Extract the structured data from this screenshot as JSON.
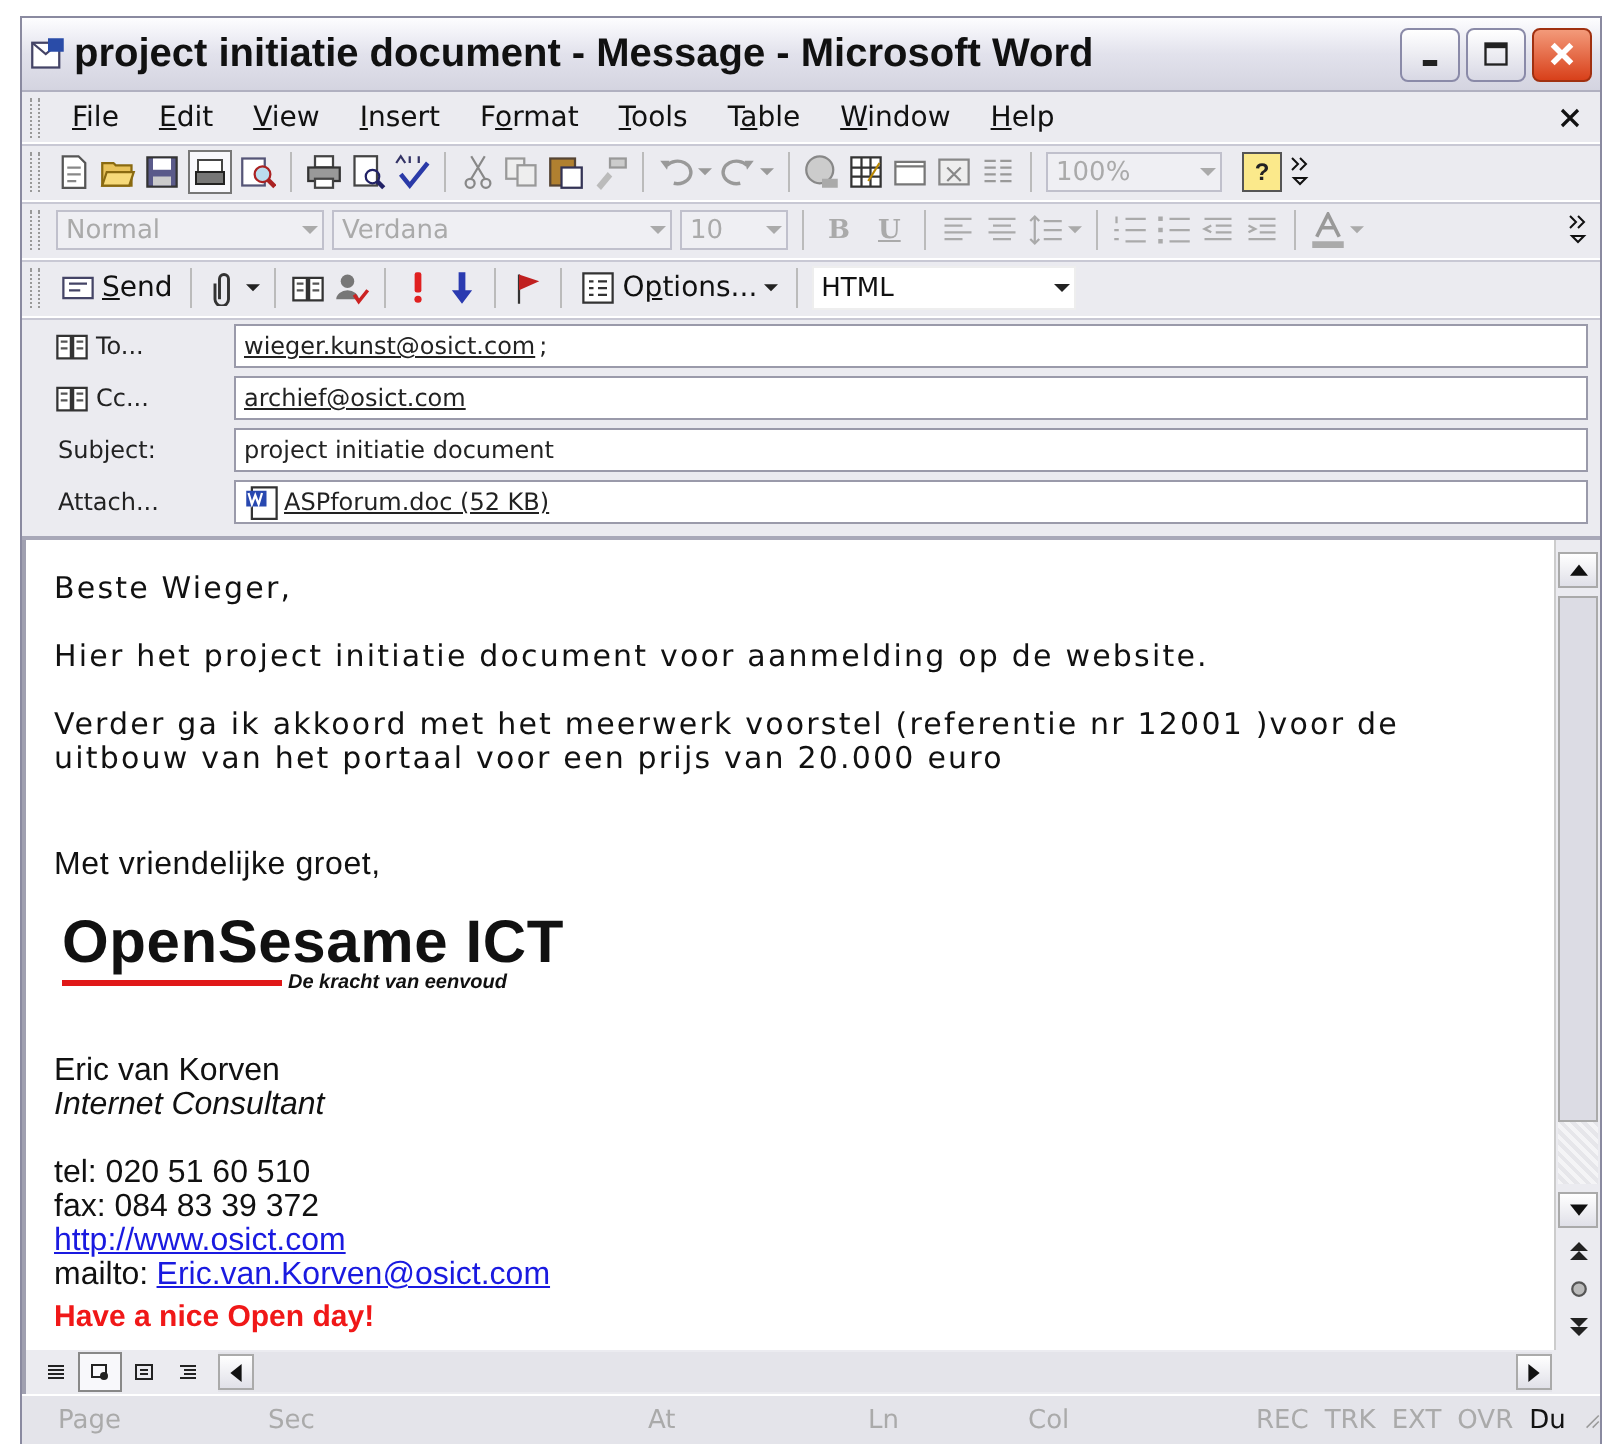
{
  "window": {
    "title": "project initiatie document - Message - Microsoft Word"
  },
  "menu": [
    {
      "key": "F",
      "after": "ile"
    },
    {
      "key": "E",
      "after": "dit"
    },
    {
      "key": "V",
      "after": "iew"
    },
    {
      "key": "I",
      "after": "nsert"
    },
    {
      "before": "F",
      "key": "o",
      "after": "rmat"
    },
    {
      "key": "T",
      "after": "ools"
    },
    {
      "before": "T",
      "key": "a",
      "after": "ble"
    },
    {
      "key": "W",
      "after": "indow"
    },
    {
      "key": "H",
      "after": "elp"
    }
  ],
  "standard_toolbar": {
    "zoom": {
      "value": "100%",
      "disabled": true
    },
    "help": "?"
  },
  "formatting_toolbar": {
    "style": {
      "value": "Normal",
      "disabled": true
    },
    "font": {
      "value": "Verdana",
      "disabled": true
    },
    "size": {
      "value": "10",
      "disabled": true
    },
    "bold": {
      "label": "B",
      "disabled": true
    },
    "underline": {
      "label": "U",
      "disabled": true
    }
  },
  "mail_toolbar": {
    "send": {
      "key": "S",
      "after": "end"
    },
    "options": {
      "before": "O",
      "key": "p",
      "after": "tions..."
    },
    "format": "HTML"
  },
  "fields": [
    {
      "kind": "address",
      "label": "To...",
      "value": "wieger.kunst@osict.com",
      "suffix": ";"
    },
    {
      "kind": "address",
      "label": "Cc...",
      "value": "archief@osict.com"
    },
    {
      "kind": "text",
      "label": "Subject:",
      "value": "project initiatie document"
    },
    {
      "kind": "attachment",
      "label": "Attach...",
      "value": "ASPforum.doc (52 KB)"
    }
  ],
  "body": {
    "greeting": "Beste Wieger,",
    "paragraphs": [
      "Hier het project initiatie document voor aanmelding op de website.",
      "Verder ga ik akkoord met het meerwerk voorstel (referentie nr 12001 )voor de uitbouw van het portaal voor een prijs van 20.000 euro"
    ],
    "closing": "Met vriendelijke groet,",
    "logo": {
      "name": "OpenSesame ICT",
      "tagline": "De kracht van eenvoud"
    },
    "signature": [
      {
        "kind": "plain",
        "text": "Eric van Korven"
      },
      {
        "kind": "italic",
        "text": "Internet Consultant"
      }
    ],
    "contact": [
      {
        "kind": "plain",
        "text": "tel: 020 51 60 510"
      },
      {
        "kind": "plain",
        "text": "fax: 084 83 39 372"
      },
      {
        "kind": "link",
        "text": "http://www.osict.com"
      },
      {
        "kind": "link",
        "prefix": "mailto:",
        "text": "Eric.van.Korven@osict.com"
      }
    ],
    "motto": "Have a nice Open day!"
  },
  "view_buttons": [
    {
      "selected": false
    },
    {
      "selected": true
    },
    {
      "selected": false
    },
    {
      "selected": false
    }
  ],
  "status_bar": {
    "fields": [
      "Page",
      "Sec",
      "At",
      "Ln",
      "Col"
    ],
    "indicators": [
      {
        "label": "REC",
        "disabled": true
      },
      {
        "label": "TRK",
        "disabled": true
      },
      {
        "label": "EXT",
        "disabled": true
      },
      {
        "label": "OVR",
        "disabled": true
      },
      {
        "label": "Du",
        "disabled": false
      }
    ]
  }
}
